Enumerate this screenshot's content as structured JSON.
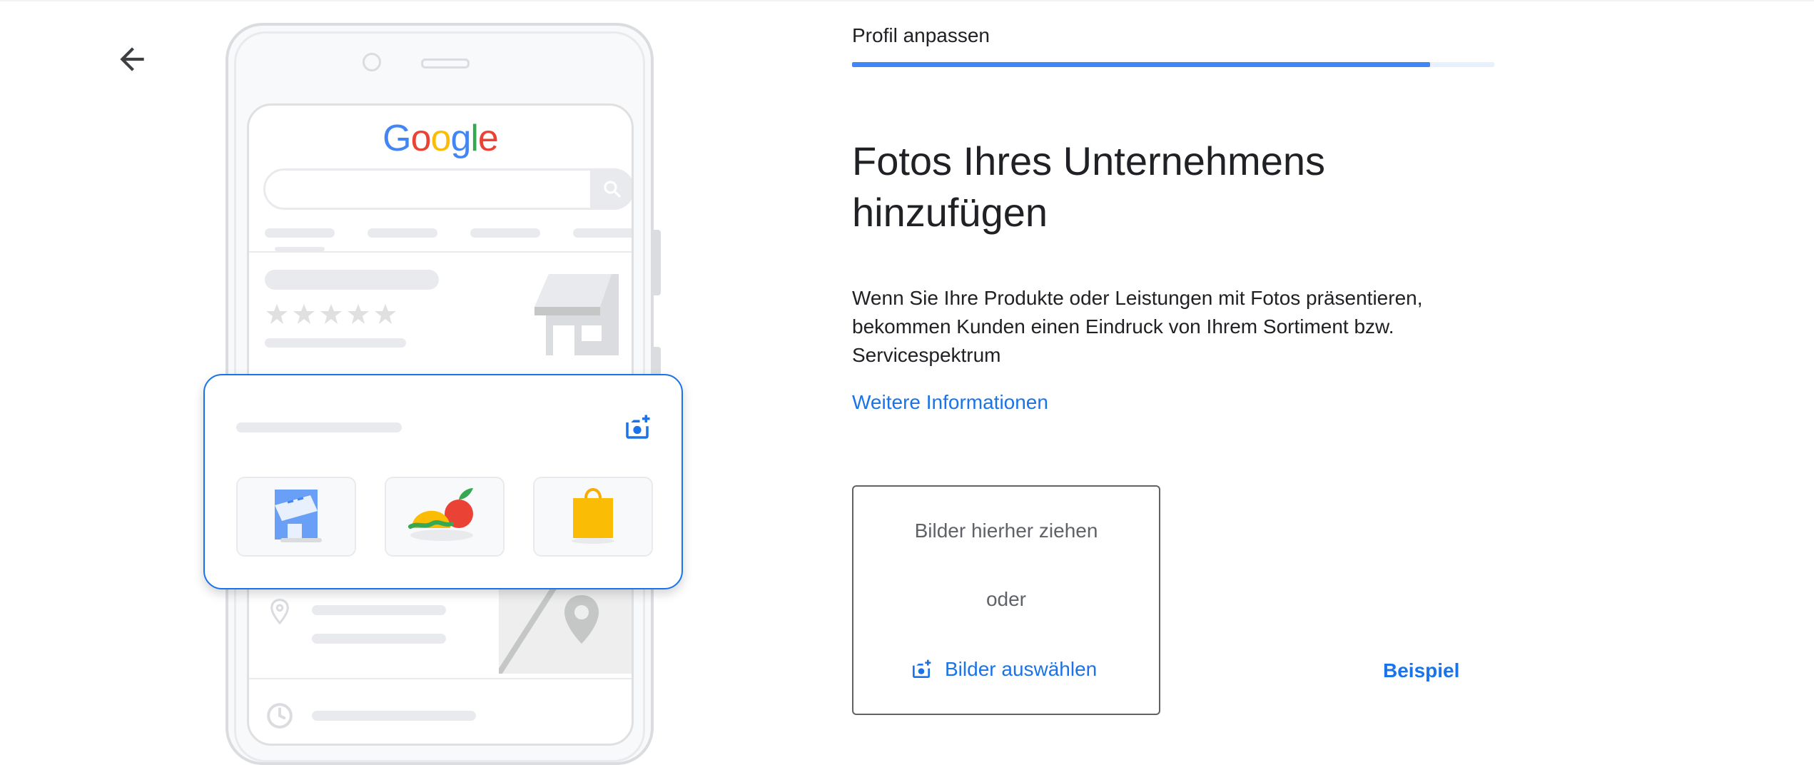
{
  "header": {
    "back_icon": "arrow-left-icon",
    "step_title": "Profil anpassen",
    "progress": 0.9
  },
  "illustration": {
    "search_engine_logo": "Google",
    "logo_colors": [
      "#4285f4",
      "#ea4335",
      "#fbbc05",
      "#4285f4",
      "#34a853",
      "#ea4335"
    ],
    "photo_categories": [
      "storefront-icon",
      "food-icon",
      "shopping-bag-icon"
    ]
  },
  "main": {
    "headline": "Fotos Ihres Unternehmens hinzufügen",
    "description": "Wenn Sie Ihre Produkte oder Leistungen mit Fotos präsentieren, bekommen Kunden einen Eindruck von Ihrem Sortiment bzw. Servicespektrum",
    "learn_more": "Weitere Informationen"
  },
  "dropzone": {
    "drag_label": "Bilder hierher ziehen",
    "or_label": "oder",
    "select_label": "Bilder auswählen",
    "select_icon": "add-photo-icon"
  },
  "example_link": "Beispiel",
  "colors": {
    "accent": "#1a73e8",
    "progress": "#4285f4",
    "text": "#202124"
  }
}
